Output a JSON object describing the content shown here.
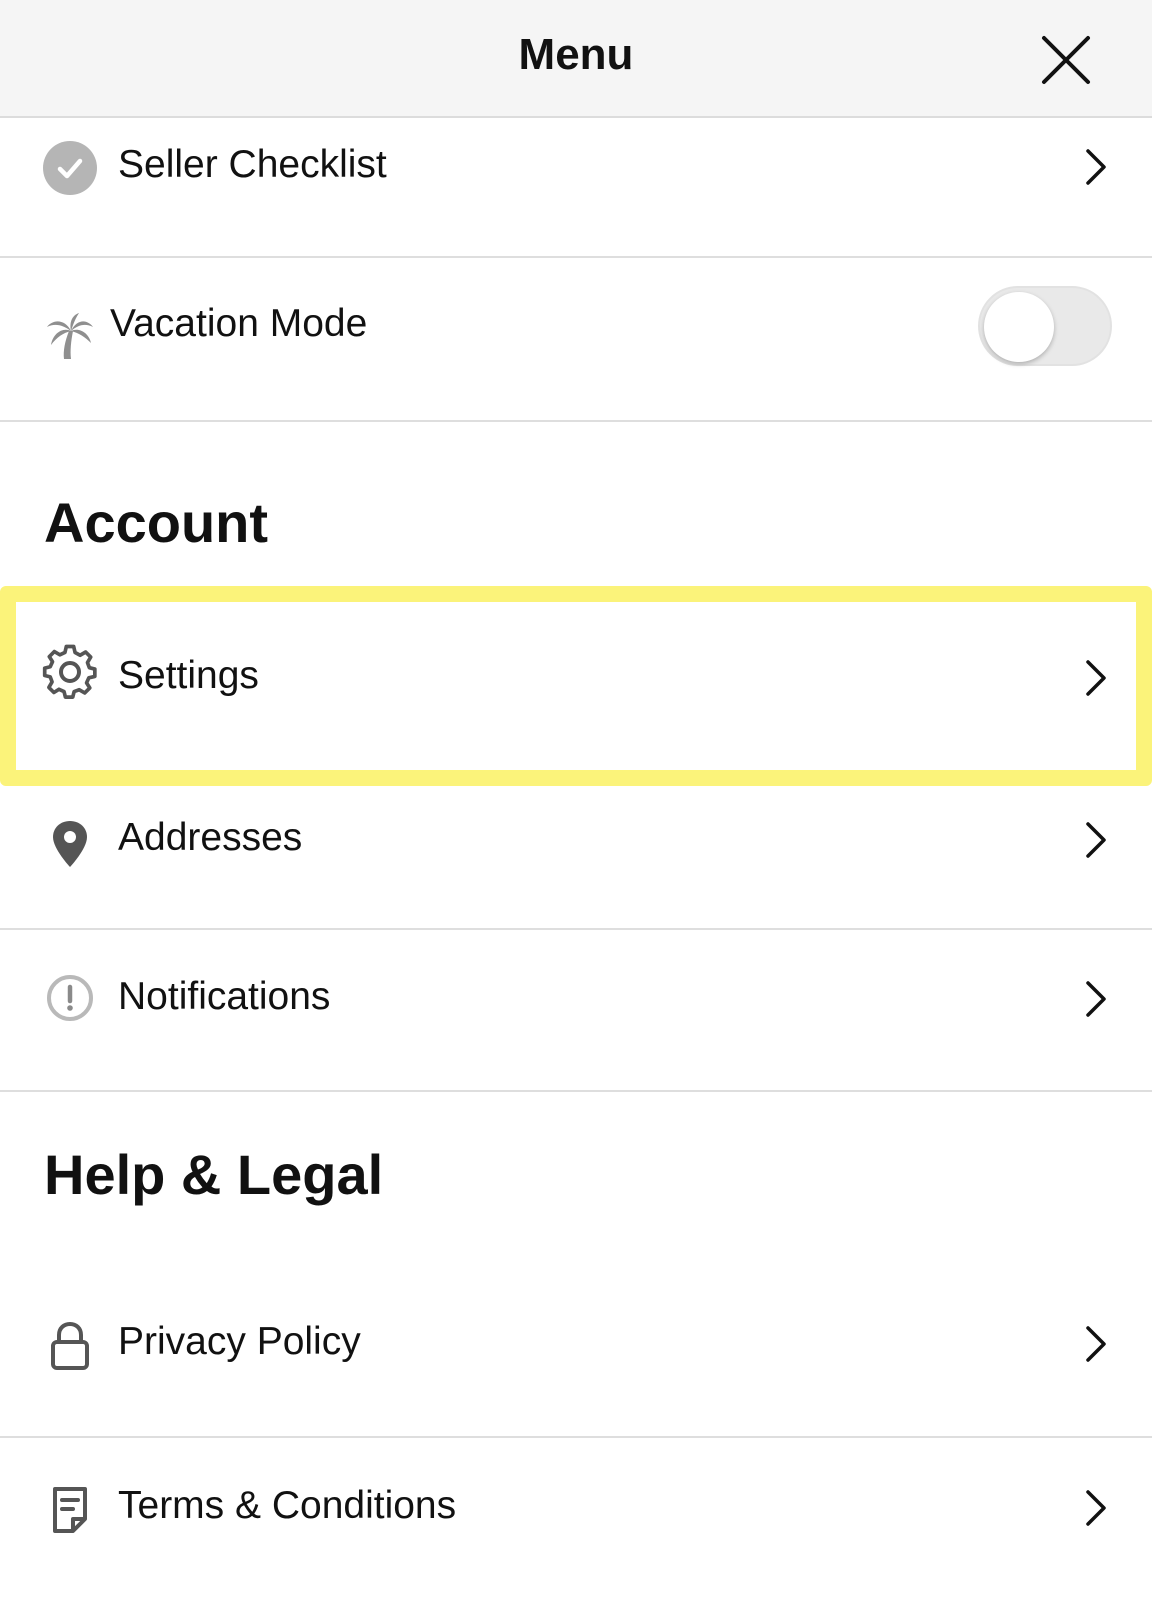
{
  "header": {
    "title": "Menu"
  },
  "rows": {
    "seller_checklist": {
      "label": "Seller Checklist"
    },
    "vacation_mode": {
      "label": "Vacation Mode",
      "toggle_on": false
    },
    "settings": {
      "label": "Settings"
    },
    "addresses": {
      "label": "Addresses"
    },
    "notifications": {
      "label": "Notifications"
    },
    "privacy_policy": {
      "label": "Privacy Policy"
    },
    "terms": {
      "label": "Terms & Conditions"
    }
  },
  "sections": {
    "account": "Account",
    "help_legal": "Help & Legal"
  },
  "icons": {
    "close": "close-icon",
    "checklist": "check-circle-icon",
    "vacation": "palm-tree-icon",
    "settings": "gear-icon",
    "addresses": "map-pin-icon",
    "notifications": "alert-circle-icon",
    "privacy": "lock-icon",
    "terms": "document-icon",
    "chevron": "chevron-right-icon"
  },
  "colors": {
    "highlight": "#fbf37a",
    "header_bg": "#f5f5f5",
    "icon_gray": "#9a9a9a"
  }
}
